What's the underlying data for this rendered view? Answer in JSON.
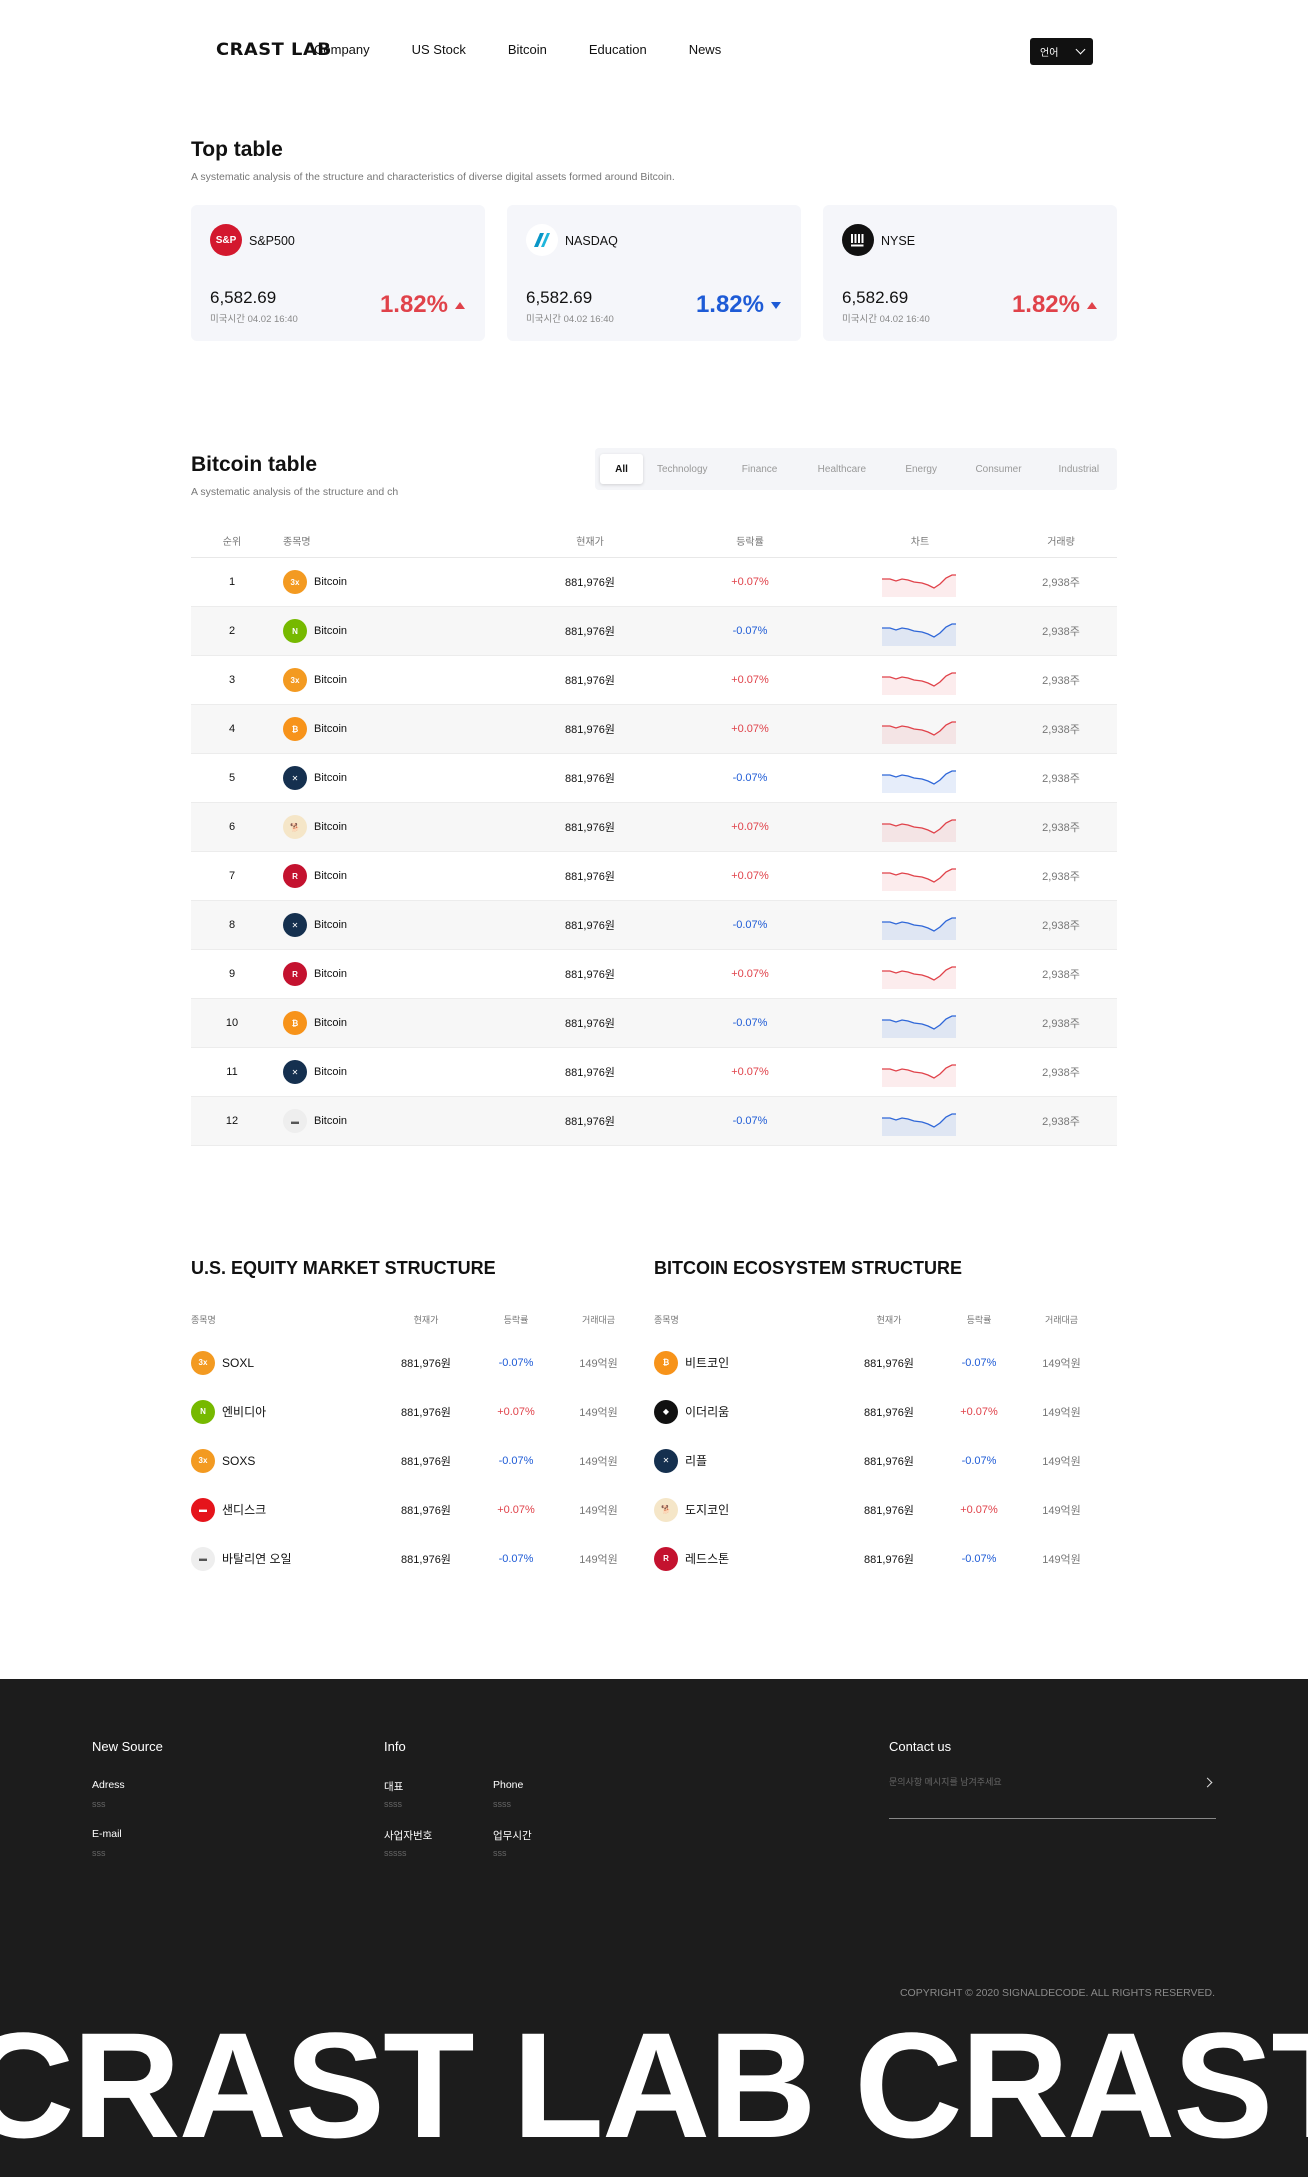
{
  "header": {
    "logo": "CRAST LAB",
    "nav": [
      "Company",
      "US Stock",
      "Bitcoin",
      "Education",
      "News"
    ],
    "lang_label": "언어"
  },
  "top_table": {
    "title": "Top table",
    "subtitle": "A systematic analysis of the structure and characteristics of diverse digital assets formed around Bitcoin.",
    "cards": [
      {
        "name": "S&P500",
        "logo_text": "S&P",
        "logo_color": "#d3182e",
        "value": "6,582.69",
        "time": "미국시간 04.02 16:40",
        "pct": "1.82%",
        "direction": "up"
      },
      {
        "name": "NASDAQ",
        "logo_text": "N",
        "logo_color": "#ffffff",
        "value": "6,582.69",
        "time": "미국시간 04.02 16:40",
        "pct": "1.82%",
        "direction": "down"
      },
      {
        "name": "NYSE",
        "logo_text": "NYSE",
        "logo_color": "#111111",
        "value": "6,582.69",
        "time": "미국시간 04.02 16:40",
        "pct": "1.82%",
        "direction": "up"
      }
    ]
  },
  "bitcoin_table": {
    "title": "Bitcoin table",
    "subtitle": "A systematic analysis of the structure and ch",
    "tabs": [
      "All",
      "Technology",
      "Finance",
      "Healthcare",
      "Energy",
      "Consumer",
      "Industrial"
    ],
    "active_tab": "All",
    "headers": {
      "rank": "순위",
      "name": "종목명",
      "price": "현재가",
      "change": "등락률",
      "chart": "차트",
      "volume": "거래량"
    },
    "rows": [
      {
        "rank": "1",
        "icon": "soxl-icon",
        "color": "#f39a21",
        "glyph": "3x",
        "name": "Bitcoin",
        "price": "881,976원",
        "change": "+0.07%",
        "dir": "up",
        "volume": "2,938주"
      },
      {
        "rank": "2",
        "icon": "nvidia-icon",
        "color": "#76b900",
        "glyph": "N",
        "name": "Bitcoin",
        "price": "881,976원",
        "change": "-0.07%",
        "dir": "down",
        "volume": "2,938주"
      },
      {
        "rank": "3",
        "icon": "soxl-icon",
        "color": "#f39a21",
        "glyph": "3x",
        "name": "Bitcoin",
        "price": "881,976원",
        "change": "+0.07%",
        "dir": "up",
        "volume": "2,938주"
      },
      {
        "rank": "4",
        "icon": "bitcoin-icon",
        "color": "#f7931a",
        "glyph": "₿",
        "name": "Bitcoin",
        "price": "881,976원",
        "change": "+0.07%",
        "dir": "up",
        "volume": "2,938주"
      },
      {
        "rank": "5",
        "icon": "ripple-icon",
        "color": "#15304f",
        "glyph": "✕",
        "name": "Bitcoin",
        "price": "881,976원",
        "change": "-0.07%",
        "dir": "down",
        "volume": "2,938주"
      },
      {
        "rank": "6",
        "icon": "dogecoin-icon",
        "color": "#f5e6c8",
        "glyph": "🐕",
        "name": "Bitcoin",
        "price": "881,976원",
        "change": "+0.07%",
        "dir": "up",
        "volume": "2,938주"
      },
      {
        "rank": "7",
        "icon": "redstone-icon",
        "color": "#c4122f",
        "glyph": "R",
        "name": "Bitcoin",
        "price": "881,976원",
        "change": "+0.07%",
        "dir": "up",
        "volume": "2,938주"
      },
      {
        "rank": "8",
        "icon": "ripple-icon",
        "color": "#15304f",
        "glyph": "✕",
        "name": "Bitcoin",
        "price": "881,976원",
        "change": "-0.07%",
        "dir": "down",
        "volume": "2,938주"
      },
      {
        "rank": "9",
        "icon": "redstone-icon",
        "color": "#c4122f",
        "glyph": "R",
        "name": "Bitcoin",
        "price": "881,976원",
        "change": "+0.07%",
        "dir": "up",
        "volume": "2,938주"
      },
      {
        "rank": "10",
        "icon": "bitcoin-icon",
        "color": "#f7931a",
        "glyph": "₿",
        "name": "Bitcoin",
        "price": "881,976원",
        "change": "-0.07%",
        "dir": "down",
        "volume": "2,938주"
      },
      {
        "rank": "11",
        "icon": "ripple-icon",
        "color": "#15304f",
        "glyph": "✕",
        "name": "Bitcoin",
        "price": "881,976원",
        "change": "+0.07%",
        "dir": "up",
        "volume": "2,938주"
      },
      {
        "rank": "12",
        "icon": "vital-energy-icon",
        "color": "#eeeeee",
        "glyph": "▬",
        "name": "Bitcoin",
        "price": "881,976원",
        "change": "-0.07%",
        "dir": "down",
        "volume": "2,938주"
      }
    ]
  },
  "us_equity": {
    "title": "U.S. EQUITY MARKET STRUCTURE",
    "headers": {
      "name": "종목명",
      "price": "현재가",
      "change": "등락률",
      "volume": "거래대금"
    },
    "rows": [
      {
        "icon": "soxl-icon",
        "color": "#f39a21",
        "glyph": "3x",
        "name": "SOXL",
        "price": "881,976원",
        "change": "-0.07%",
        "dir": "down",
        "volume": "149억원"
      },
      {
        "icon": "nvidia-icon",
        "color": "#76b900",
        "glyph": "N",
        "name": "엔비디아",
        "price": "881,976원",
        "change": "+0.07%",
        "dir": "up",
        "volume": "149억원"
      },
      {
        "icon": "soxs-icon",
        "color": "#f39a21",
        "glyph": "3x",
        "name": "SOXS",
        "price": "881,976원",
        "change": "-0.07%",
        "dir": "down",
        "volume": "149억원"
      },
      {
        "icon": "sandisk-icon",
        "color": "#e5141b",
        "glyph": "▬",
        "name": "샌디스크",
        "price": "881,976원",
        "change": "+0.07%",
        "dir": "up",
        "volume": "149억원"
      },
      {
        "icon": "vital-energy-icon",
        "color": "#eeeeee",
        "glyph": "▬",
        "name": "바탈리연 오일",
        "price": "881,976원",
        "change": "-0.07%",
        "dir": "down",
        "volume": "149억원"
      }
    ]
  },
  "btc_ecosystem": {
    "title": "BITCOIN ECOSYSTEM STRUCTURE",
    "headers": {
      "name": "종목명",
      "price": "현재가",
      "change": "등락률",
      "volume": "거래대금"
    },
    "rows": [
      {
        "icon": "bitcoin-icon",
        "color": "#f7931a",
        "glyph": "₿",
        "name": "비트코인",
        "price": "881,976원",
        "change": "-0.07%",
        "dir": "down",
        "volume": "149억원"
      },
      {
        "icon": "ethereum-icon",
        "color": "#111111",
        "glyph": "◆",
        "name": "이더리움",
        "price": "881,976원",
        "change": "+0.07%",
        "dir": "up",
        "volume": "149억원"
      },
      {
        "icon": "ripple-icon",
        "color": "#15304f",
        "glyph": "✕",
        "name": "리플",
        "price": "881,976원",
        "change": "-0.07%",
        "dir": "down",
        "volume": "149억원"
      },
      {
        "icon": "dogecoin-icon",
        "color": "#f5e6c8",
        "glyph": "🐕",
        "name": "도지코인",
        "price": "881,976원",
        "change": "+0.07%",
        "dir": "up",
        "volume": "149억원"
      },
      {
        "icon": "redstone-icon",
        "color": "#c4122f",
        "glyph": "R",
        "name": "레드스톤",
        "price": "881,976원",
        "change": "-0.07%",
        "dir": "down",
        "volume": "149억원"
      }
    ]
  },
  "footer": {
    "new_source": {
      "title": "New Source",
      "address_label": "Adress",
      "address_value": "sss",
      "email_label": "E-mail",
      "email_value": "sss"
    },
    "info": {
      "title": "Info",
      "ceo_label": "대표",
      "ceo_value": "ssss",
      "phone_label": "Phone",
      "phone_value": "ssss",
      "biz_label": "사업자번호",
      "biz_value": "sssss",
      "hours_label": "업무시간",
      "hours_value": "sss"
    },
    "contact": {
      "title": "Contact us",
      "placeholder": "문의사항 메시지를 남겨주세요"
    },
    "copyright": "COPYRIGHT © 2020 SIGNALDECODE. ALL RIGHTS RESERVED.",
    "marquee": "CRAST LAB CRAST LAB CRAST LAB"
  },
  "colors": {
    "up": "#e0424a",
    "down": "#1e5bd6",
    "footer_bg": "#1c1c1c"
  }
}
